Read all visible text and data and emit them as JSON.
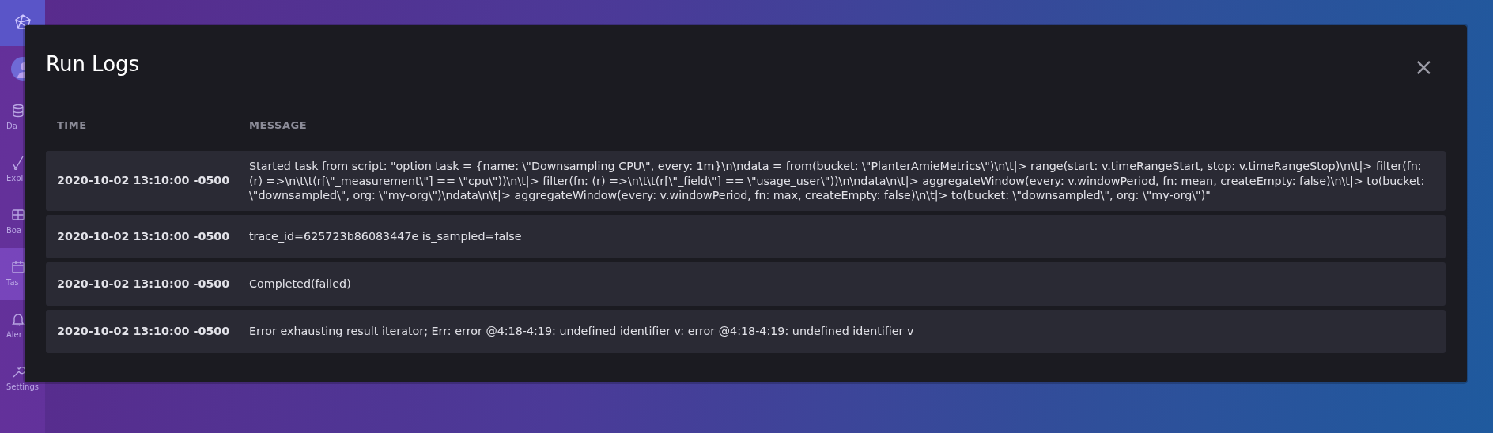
{
  "sidebar": {
    "items": [
      {
        "label": "Da",
        "selected": false
      },
      {
        "label": "Expl",
        "selected": false
      },
      {
        "label": "Boa",
        "selected": false
      },
      {
        "label": "Tas",
        "selected": true
      },
      {
        "label": "Aler",
        "selected": false
      },
      {
        "label": "Settings",
        "selected": false
      }
    ]
  },
  "modal": {
    "title": "Run Logs",
    "close": "×",
    "table": {
      "columns": [
        "TIME",
        "MESSAGE"
      ],
      "rows": [
        {
          "time": "2020-10-02 13:10:00 -0500",
          "message": "Started task from script: \"option task = {name: \\\"Downsampling CPU\\\", every: 1m}\\n\\ndata = from(bucket: \\\"PlanterAmieMetrics\\\")\\n\\t|> range(start: v.timeRangeStart, stop: v.timeRangeStop)\\n\\t|> filter(fn: (r) =>\\n\\t\\t(r[\\\"_measurement\\\"] == \\\"cpu\\\"))\\n\\t|> filter(fn: (r) =>\\n\\t\\t(r[\\\"_field\\\"] == \\\"usage_user\\\"))\\n\\ndata\\n\\t|> aggregateWindow(every: v.windowPeriod, fn: mean, createEmpty: false)\\n\\t|> to(bucket: \\\"downsampled\\\", org: \\\"my-org\\\")\\ndata\\n\\t|> aggregateWindow(every: v.windowPeriod, fn: max, createEmpty: false)\\n\\t|> to(bucket: \\\"downsampled\\\", org: \\\"my-org\\\")\""
        },
        {
          "time": "2020-10-02 13:10:00 -0500",
          "message": "trace_id=625723b86083447e is_sampled=false"
        },
        {
          "time": "2020-10-02 13:10:00 -0500",
          "message": "Completed(failed)"
        },
        {
          "time": "2020-10-02 13:10:00 -0500",
          "message": "Error exhausting result iterator; Err: error @4:18-4:19: undefined identifier v: error @4:18-4:19: undefined identifier v"
        }
      ]
    }
  }
}
